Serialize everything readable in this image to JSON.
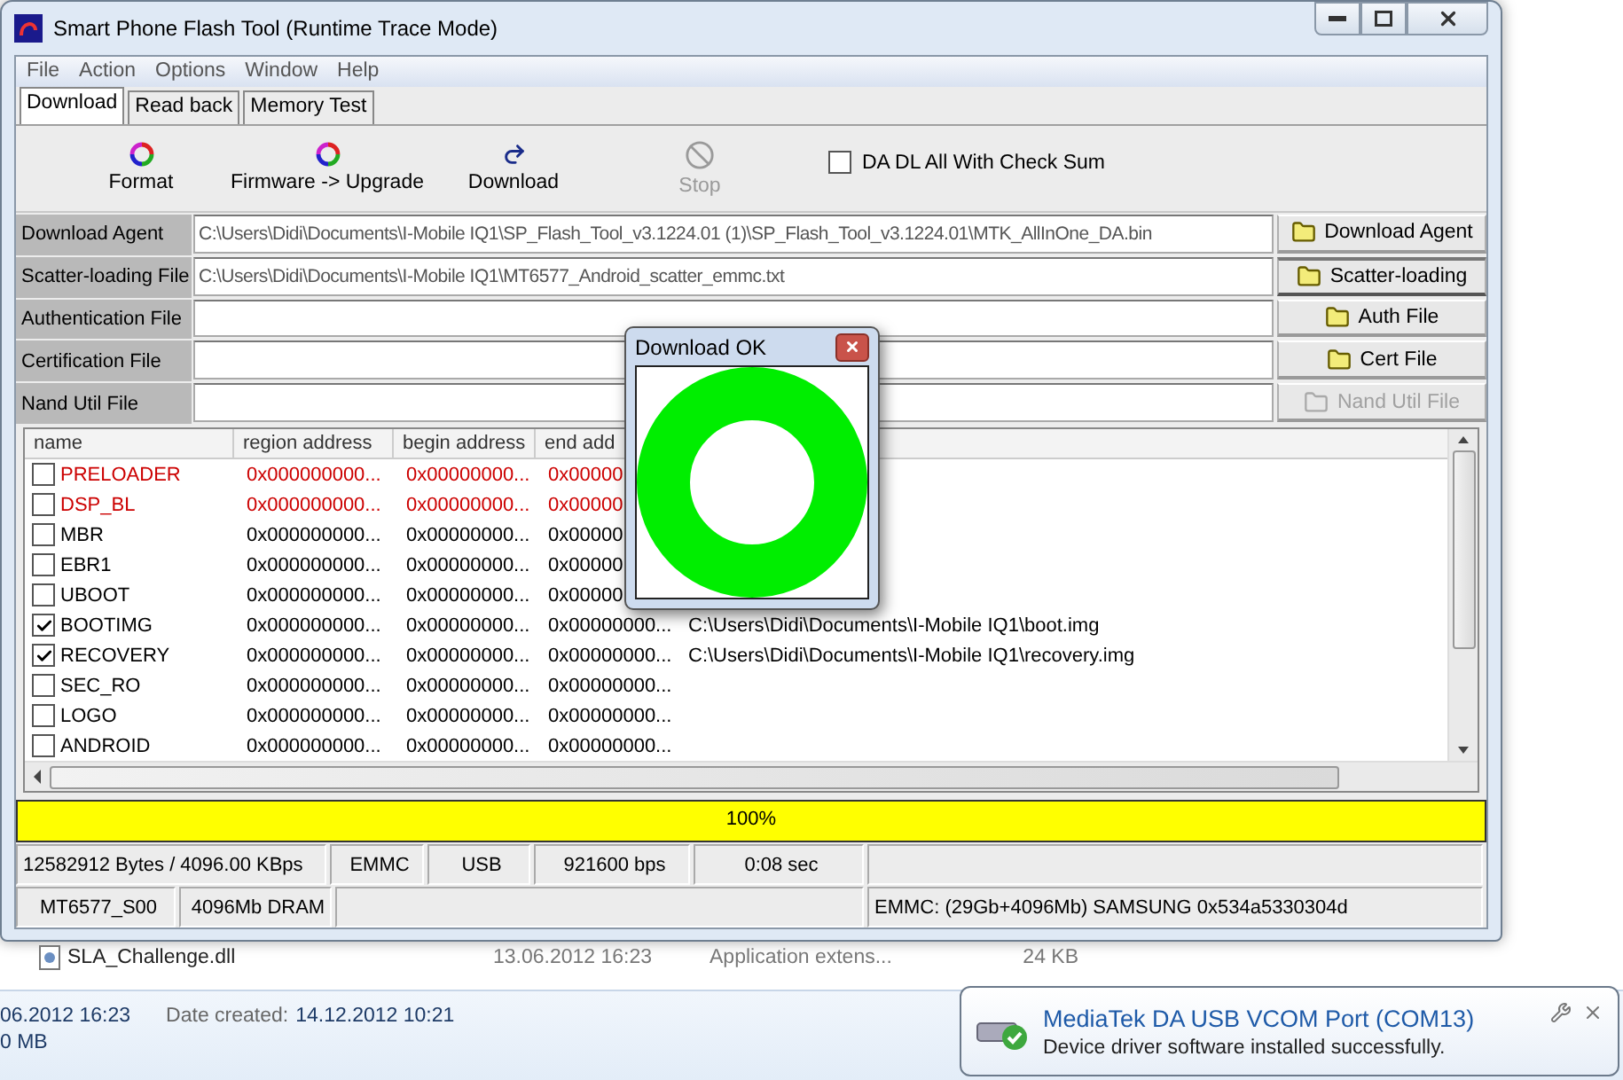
{
  "window": {
    "title": "Smart Phone Flash Tool (Runtime Trace Mode)"
  },
  "menu": [
    "File",
    "Action",
    "Options",
    "Window",
    "Help"
  ],
  "tabs": [
    {
      "label": "Download",
      "selected": true
    },
    {
      "label": "Read back",
      "selected": false
    },
    {
      "label": "Memory Test",
      "selected": false
    }
  ],
  "toolbar": [
    {
      "label": "Format",
      "kind": "format",
      "disabled": false
    },
    {
      "label": "Firmware -> Upgrade",
      "kind": "format",
      "disabled": false
    },
    {
      "label": "Download",
      "kind": "download",
      "disabled": false
    },
    {
      "label": "Stop",
      "kind": "stop",
      "disabled": true
    }
  ],
  "check_sum": {
    "label": "DA DL All With Check Sum",
    "checked": false
  },
  "files": [
    {
      "label": "Download Agent",
      "value": "C:\\Users\\Didi\\Documents\\I-Mobile IQ1\\SP_Flash_Tool_v3.1224.01 (1)\\SP_Flash_Tool_v3.1224.01\\MTK_AllInOne_DA.bin",
      "button": "Download Agent",
      "pressed": false,
      "disabled": false
    },
    {
      "label": "Scatter-loading File",
      "value": "C:\\Users\\Didi\\Documents\\I-Mobile IQ1\\MT6577_Android_scatter_emmc.txt",
      "button": "Scatter-loading",
      "pressed": true,
      "disabled": false
    },
    {
      "label": "Authentication File",
      "button": "Auth File",
      "pressed": false,
      "disabled": false
    },
    {
      "label": "Certification File",
      "button": "Cert File",
      "pressed": false,
      "disabled": false
    },
    {
      "label": "Nand Util File",
      "button": "Nand Util File",
      "pressed": false,
      "disabled": true
    }
  ],
  "table": {
    "columns": [
      "name",
      "region address",
      "begin address",
      "end add"
    ],
    "rows": [
      {
        "name": "PRELOADER",
        "checked": false,
        "color": "#cc0000",
        "region": "0x000000000...",
        "begin": "0x00000000...",
        "end": "0x00000"
      },
      {
        "name": "DSP_BL",
        "checked": false,
        "color": "#cc0000",
        "region": "0x000000000...",
        "begin": "0x00000000...",
        "end": "0x00000"
      },
      {
        "name": "MBR",
        "checked": false,
        "color": "#000000",
        "region": "0x000000000...",
        "begin": "0x00000000...",
        "end": "0x00000"
      },
      {
        "name": "EBR1",
        "checked": false,
        "color": "#000000",
        "region": "0x000000000...",
        "begin": "0x00000000...",
        "end": "0x00000"
      },
      {
        "name": "UBOOT",
        "checked": false,
        "color": "#000000",
        "region": "0x000000000...",
        "begin": "0x00000000...",
        "end": "0x00000"
      },
      {
        "name": "BOOTIMG",
        "checked": true,
        "color": "#000000",
        "region": "0x000000000...",
        "begin": "0x00000000...",
        "end": "0x00000000...",
        "location": "C:\\Users\\Didi\\Documents\\I-Mobile IQ1\\boot.img"
      },
      {
        "name": "RECOVERY",
        "checked": true,
        "color": "#000000",
        "region": "0x000000000...",
        "begin": "0x00000000...",
        "end": "0x00000000...",
        "location": "C:\\Users\\Didi\\Documents\\I-Mobile IQ1\\recovery.img"
      },
      {
        "name": "SEC_RO",
        "checked": false,
        "color": "#000000",
        "region": "0x000000000...",
        "begin": "0x00000000...",
        "end": "0x00000000..."
      },
      {
        "name": "LOGO",
        "checked": false,
        "color": "#000000",
        "region": "0x000000000...",
        "begin": "0x00000000...",
        "end": "0x00000000..."
      },
      {
        "name": "ANDROID",
        "checked": false,
        "color": "#000000",
        "region": "0x000000000...",
        "begin": "0x00000000...",
        "end": "0x00000000..."
      }
    ]
  },
  "progress": {
    "level": 1,
    "reading": "100%"
  },
  "status_bar": {
    "row_1": [
      "12582912 Bytes / 4096.00 KBps",
      "EMMC",
      "USB",
      "921600 bps",
      "0:08 sec"
    ],
    "row_2": [
      "MT6577_S00",
      "4096Mb DRAM",
      "EMMC: (29Gb+4096Mb) SAMSUNG 0x534a5330304d"
    ]
  },
  "dialog": {
    "title": "Download OK"
  },
  "explorer": {
    "files": [
      {
        "name": "SLA_Challenge.dll",
        "date": "13.06.2012 16:23",
        "type": "Application extens...",
        "size": "24 KB"
      }
    ],
    "details": {
      "modified": "06.2012 16:23",
      "created_label": "Date created:",
      "created": "14.12.2012 10:21",
      "size": "0 MB"
    }
  },
  "notification": {
    "title": "MediaTek DA USB VCOM Port (COM13)",
    "message": "Device driver software installed successfully."
  }
}
